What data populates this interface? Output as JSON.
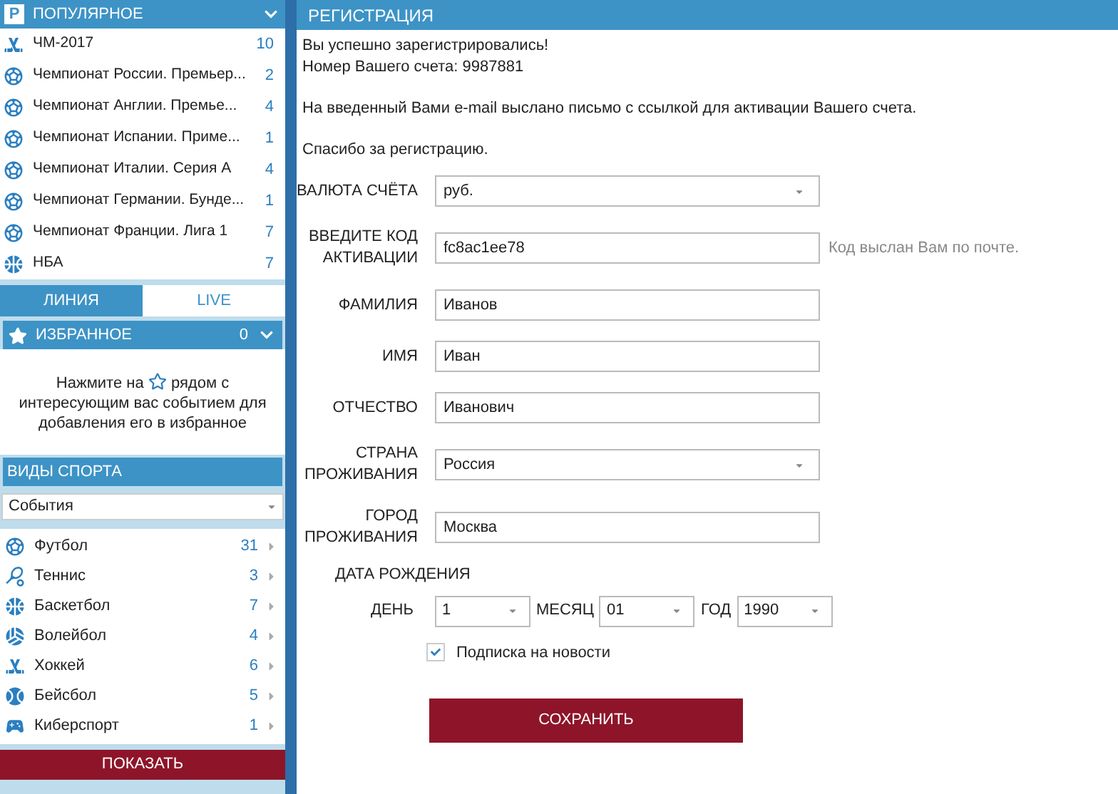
{
  "popular": {
    "logo": "P",
    "title": "ПОПУЛЯРНОЕ",
    "items": [
      {
        "kind": "hockey",
        "label": "ЧМ-2017",
        "count": "10"
      },
      {
        "kind": "football",
        "label": "Чемпионат России. Премьер...",
        "count": "2"
      },
      {
        "kind": "football",
        "label": "Чемпионат Англии. Премье...",
        "count": "4"
      },
      {
        "kind": "football",
        "label": "Чемпионат Испании. Приме...",
        "count": "1"
      },
      {
        "kind": "football",
        "label": "Чемпионат Италии. Серия А",
        "count": "4"
      },
      {
        "kind": "football",
        "label": "Чемпионат Германии. Бунде...",
        "count": "1"
      },
      {
        "kind": "football",
        "label": "Чемпионат Франции. Лига 1",
        "count": "7"
      },
      {
        "kind": "basketball",
        "label": "НБА",
        "count": "7"
      }
    ]
  },
  "tabs": [
    {
      "label": "ЛИНИЯ",
      "selected": true
    },
    {
      "label": "LIVE",
      "selected": false
    }
  ],
  "favorites": {
    "title": "ИЗБРАННОЕ",
    "count": "0",
    "hint_before": "Нажмите на",
    "hint_after": "рядом с интересующим вас событием для добавления его в избранное"
  },
  "sports": {
    "title": "ВИДЫ СПОРТА",
    "filter": "События",
    "items": [
      {
        "kind": "football",
        "label": "Футбол",
        "count": "31"
      },
      {
        "kind": "tennis",
        "label": "Теннис",
        "count": "3"
      },
      {
        "kind": "basketball",
        "label": "Баскетбол",
        "count": "7"
      },
      {
        "kind": "volleyball",
        "label": "Волейбол",
        "count": "4"
      },
      {
        "kind": "hockey",
        "label": "Хоккей",
        "count": "6"
      },
      {
        "kind": "baseball",
        "label": "Бейсбол",
        "count": "5"
      },
      {
        "kind": "esports",
        "label": "Киберспорт",
        "count": "1"
      }
    ],
    "button": "ПОКАЗАТЬ"
  },
  "registration": {
    "title": "РЕГИСТРАЦИЯ",
    "success": "Вы успешно зарегистрировались!",
    "account": "Номер Вашего счета: 9987881",
    "email_note": "На введенный Вами e-mail выслано письмо с ссылкой для активации Вашего счета.",
    "thanks": "Спасибо за регистрацию.",
    "fields": [
      {
        "kind": "select",
        "label": "ВАЛЮТА СЧЁТА",
        "value": "руб."
      },
      {
        "kind": "text",
        "label": "ВВЕДИТЕ КОД АКТИВАЦИИ",
        "value": "fc8ac1ee78",
        "hint": "Код выслан Вам по почте."
      },
      {
        "kind": "text",
        "label": "ФАМИЛИЯ",
        "value": "Иванов"
      },
      {
        "kind": "text",
        "label": "ИМЯ",
        "value": "Иван"
      },
      {
        "kind": "text",
        "label": "ОТЧЕСТВО",
        "value": "Иванович"
      },
      {
        "kind": "select",
        "label": "СТРАНА ПРОЖИВАНИЯ",
        "value": "Россия"
      },
      {
        "kind": "text",
        "label": "ГОРОД ПРОЖИВАНИЯ",
        "value": "Москва"
      }
    ],
    "birth_title": "ДАТА РОЖДЕНИЯ",
    "birth": [
      {
        "label": "ДЕНЬ",
        "value": "1"
      },
      {
        "label": "МЕСЯЦ",
        "value": "01"
      },
      {
        "label": "ГОД",
        "value": "1990"
      }
    ],
    "newsletter": {
      "label": "Подписка на новости",
      "checked": true
    },
    "save": "СОХРАНИТЬ"
  }
}
